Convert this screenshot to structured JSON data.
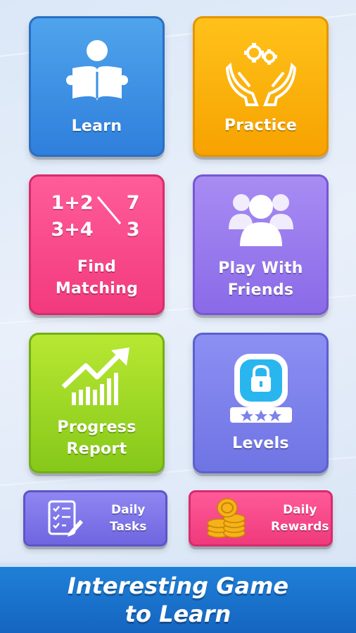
{
  "tiles": {
    "learn": {
      "label": "Learn",
      "icon": "reading-student-icon",
      "color": "#3b8fe6"
    },
    "practice": {
      "label": "Practice",
      "icon": "hands-gears-icon",
      "color": "#fbb00c"
    },
    "find_matching": {
      "label_line1": "Find",
      "label_line2": "Matching",
      "icon": "match-numbers-icon",
      "color": "#f4468a",
      "expr1": "1+2",
      "expr2": "3+4",
      "ans1": "7",
      "ans2": "3"
    },
    "play_with_friends": {
      "label_line1": "Play With",
      "label_line2": "Friends",
      "icon": "group-users-icon",
      "color": "#9a7cef"
    },
    "progress_report": {
      "label_line1": "Progress",
      "label_line2": "Report",
      "icon": "growth-chart-icon",
      "color": "#9ed626"
    },
    "levels": {
      "label": "Levels",
      "icon": "locked-level-icon",
      "color": "#7d82eb"
    }
  },
  "buttons": {
    "daily_tasks": {
      "label_line1": "Daily",
      "label_line2": "Tasks",
      "icon": "checklist-icon",
      "color": "#7f76ea"
    },
    "daily_rewards": {
      "label_line1": "Daily",
      "label_line2": "Rewards",
      "icon": "coins-icon",
      "color": "#f74a8a"
    }
  },
  "banner": {
    "line1": "Interesting Game",
    "line2": "to Learn",
    "color": "#1a73cc"
  }
}
